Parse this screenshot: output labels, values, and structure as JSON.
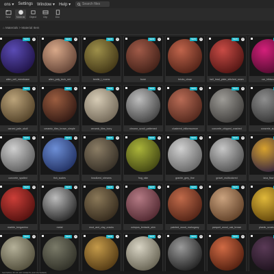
{
  "menubar": {
    "items": [
      "ons ▾",
      "Settings",
      "Window ▾",
      "Help ▾"
    ],
    "search_placeholder": "Search files"
  },
  "toolbar": {
    "icons": [
      {
        "name": "new-folder-icon",
        "label": "New"
      },
      {
        "name": "sphere-icon",
        "label": "Material"
      },
      {
        "name": "box-icon",
        "label": "Object"
      },
      {
        "name": "film-icon",
        "label": "Clip"
      },
      {
        "name": "document-icon",
        "label": "Doc"
      }
    ]
  },
  "breadcrumb": "⌂  Materials > Material Item",
  "tiles": [
    {
      "name": "alien_cell_membrane",
      "colors": [
        "#5a4bb4",
        "#1c1040"
      ],
      "badge": "NEW"
    },
    {
      "name": "alien_poly_tech_net",
      "colors": [
        "#d8a889",
        "#5a3c30"
      ],
      "badge": "NEW"
    },
    {
      "name": "beetle_l_rooms",
      "colors": [
        "#9d8f4a",
        "#3a2f12"
      ],
      "badge": "NEW"
    },
    {
      "name": "bone",
      "colors": [
        "#a05a48",
        "#3a1c14"
      ],
      "badge": "NEW"
    },
    {
      "name": "bricks_clean",
      "colors": [
        "#c0644b",
        "#4a1e14"
      ],
      "badge": "NEW"
    },
    {
      "name": "bull_lead_plate_stitched_seam",
      "colors": [
        "#c84b45",
        "#4a1210"
      ],
      "badge": "NEW"
    },
    {
      "name": "car_hibiscus",
      "colors": [
        "#d4207a",
        "#4a0a2a"
      ],
      "badge": "NEW"
    },
    {
      "name": "carved_jade_skull",
      "colors": [
        "#bba37a",
        "#4a3a22"
      ],
      "badge": "NEW"
    },
    {
      "name": "ceramic_tiles_brown_simple",
      "colors": [
        "#9b5d40",
        "#2a1410"
      ],
      "badge": "NEW"
    },
    {
      "name": "ceramic_tiles_ivory",
      "colors": [
        "#d6cbb5",
        "#6a6050"
      ],
      "badge": "NEW"
    },
    {
      "name": "chrome_scroll_patterned",
      "colors": [
        "#bdbdbd",
        "#3a3a3a"
      ],
      "badge": "NEW"
    },
    {
      "name": "clustered_inflorescence",
      "colors": [
        "#b86b55",
        "#4a2218"
      ],
      "badge": "NEW"
    },
    {
      "name": "concrete_chipped_crashed",
      "colors": [
        "#9d9b96",
        "#3a3836"
      ],
      "badge": "NEW"
    },
    {
      "name": "concrete_slab",
      "colors": [
        "#8e8e8e",
        "#2e2e2e"
      ],
      "badge": "NEW"
    },
    {
      "name": "concrete_spalled",
      "colors": [
        "#cfcfcf",
        "#555555"
      ],
      "badge": "NEW"
    },
    {
      "name": "fish_scales",
      "colors": [
        "#6c8ed6",
        "#1c2a5a"
      ],
      "badge": "NEW"
    },
    {
      "name": "fossilized_streams",
      "colors": [
        "#8b7d65",
        "#2e2820"
      ],
      "badge": "NEW"
    },
    {
      "name": "frog_skin",
      "colors": [
        "#aab43a",
        "#3a3e10"
      ],
      "badge": "NEW"
    },
    {
      "name": "granite_grey_fine",
      "colors": [
        "#d0d0d0",
        "#5e5e5e"
      ],
      "badge": "NEW"
    },
    {
      "name": "gravel_multicolored",
      "colors": [
        "#c6c6c6",
        "#4a4a4a"
      ],
      "badge": "NEW"
    },
    {
      "name": "lava_flow",
      "colors": [
        "#d8a22e",
        "#2a1c40"
      ],
      "badge": "NEW"
    },
    {
      "name": "marble_bergamino",
      "colors": [
        "#cc3e38",
        "#4a0e0c"
      ],
      "badge": "NEW"
    },
    {
      "name": "metal",
      "colors": [
        "#bcbcbc",
        "#1e1e1e"
      ],
      "badge": "NEW"
    },
    {
      "name": "mud_and_clay_cracks",
      "colors": [
        "#8a7858",
        "#2e2418"
      ],
      "badge": "NEW"
    },
    {
      "name": "octopus_tentacle_skin",
      "colors": [
        "#b47a84",
        "#4a222a"
      ],
      "badge": "NEW"
    },
    {
      "name": "painted_wood_mahogany",
      "colors": [
        "#c06a4a",
        "#4a1e12"
      ],
      "badge": "NEW"
    },
    {
      "name": "parquet_wood_oak_brown",
      "colors": [
        "#caa27e",
        "#5a3a22"
      ],
      "badge": "NEW"
    },
    {
      "name": "plastic_scratched",
      "colors": [
        "#e0b83a",
        "#5a3e08"
      ],
      "badge": "NEW"
    },
    {
      "name": "rock_moss_granite",
      "colors": [
        "#b4b098",
        "#4a4634"
      ],
      "badge": "NEW"
    },
    {
      "name": "rock_cliff_layered",
      "colors": [
        "#7a7a68",
        "#2a2a22"
      ],
      "badge": "NEW"
    },
    {
      "name": "snake_skin_scales",
      "colors": [
        "#c49a4a",
        "#4a3210"
      ],
      "badge": "NEW"
    },
    {
      "name": "sponge_coral",
      "colors": [
        "#d8d4c4",
        "#5e5a4a"
      ],
      "badge": "NEW"
    },
    {
      "name": "tech_panel_mech",
      "colors": [
        "#9a9a9a",
        "#1a1a1a"
      ],
      "badge": "NEW"
    },
    {
      "name": "terracotta_rough",
      "colors": [
        "#d06a44",
        "#4a1a0c"
      ],
      "badge": "NEW"
    },
    {
      "name": "velvet_plum",
      "colors": [
        "#5a3a56",
        "#1a101a"
      ],
      "badge": "NEW"
    }
  ],
  "status": "SHOWING 35 OF 187 ASSETS (100 FILTERED)"
}
